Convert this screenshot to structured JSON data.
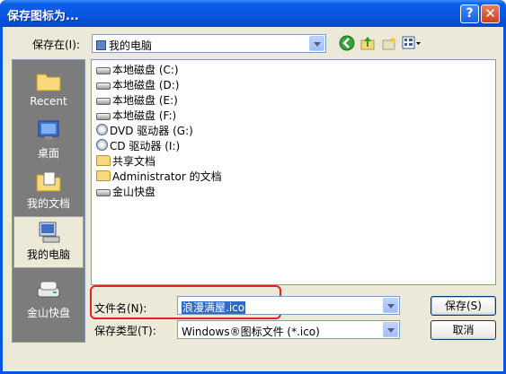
{
  "window": {
    "title": "保存图标为..."
  },
  "location": {
    "label": "保存在(I):",
    "value": "我的电脑"
  },
  "places": [
    {
      "label": "Recent"
    },
    {
      "label": "桌面"
    },
    {
      "label": "我的文档"
    },
    {
      "label": "我的电脑"
    },
    {
      "label": "金山快盘"
    }
  ],
  "items": [
    {
      "label": "本地磁盘 (C:)",
      "icon": "hard-drive-icon"
    },
    {
      "label": "本地磁盘 (D:)",
      "icon": "hard-drive-icon"
    },
    {
      "label": "本地磁盘 (E:)",
      "icon": "hard-drive-icon"
    },
    {
      "label": "本地磁盘 (F:)",
      "icon": "hard-drive-icon"
    },
    {
      "label": "DVD 驱动器 (G:)",
      "icon": "dvd-drive-icon"
    },
    {
      "label": "CD 驱动器 (I:)",
      "icon": "cd-drive-icon"
    },
    {
      "label": "共享文档",
      "icon": "folder-icon"
    },
    {
      "label": "Administrator 的文档",
      "icon": "folder-icon"
    },
    {
      "label": "金山快盘",
      "icon": "drive-icon"
    }
  ],
  "filename": {
    "label": "文件名(N):",
    "value": "浪漫满屋.ico"
  },
  "filetype": {
    "label": "保存类型(T):",
    "value": "Windows®图标文件 (*.ico)"
  },
  "buttons": {
    "save": "保存(S)",
    "cancel": "取消"
  },
  "colors": {
    "title_bar": "#0a54e3",
    "highlight": "#e12323",
    "selection": "#316ac5"
  }
}
